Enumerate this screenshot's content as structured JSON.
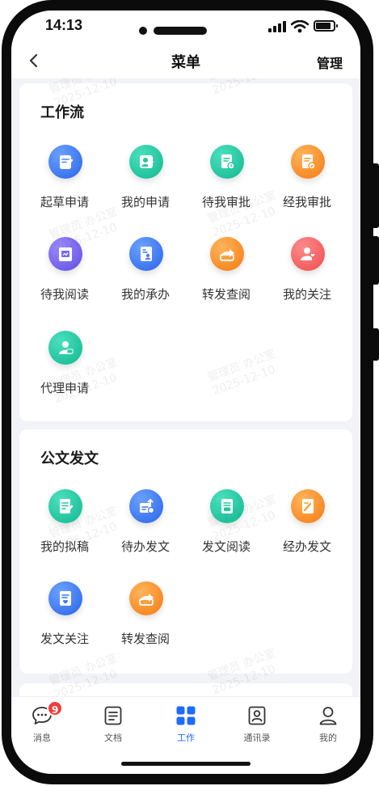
{
  "statusbar": {
    "time": "14:13"
  },
  "navbar": {
    "title": "菜单",
    "action": "管理"
  },
  "watermark": {
    "name": "管理员  办公室",
    "date": "2025-12-10"
  },
  "sections": [
    {
      "title": "工作流",
      "items": [
        {
          "label": "起草申请",
          "color": "blue",
          "icon": "edit-doc-icon"
        },
        {
          "label": "我的申请",
          "color": "teal",
          "icon": "user-sign-icon"
        },
        {
          "label": "待我审批",
          "color": "teal",
          "icon": "doc-clock-icon"
        },
        {
          "label": "经我审批",
          "color": "orange",
          "icon": "doc-check-icon"
        },
        {
          "label": "待我阅读",
          "color": "purple",
          "icon": "read-doc-icon"
        },
        {
          "label": "我的承办",
          "color": "blue",
          "icon": "id-card-icon"
        },
        {
          "label": "转发查阅",
          "color": "orange",
          "icon": "forward-icon"
        },
        {
          "label": "我的关注",
          "color": "red",
          "icon": "user-heart-icon"
        },
        {
          "label": "代理申请",
          "color": "teal",
          "icon": "agent-icon"
        }
      ]
    },
    {
      "title": "公文发文",
      "items": [
        {
          "label": "我的拟稿",
          "color": "teal",
          "icon": "draft-icon"
        },
        {
          "label": "待办发文",
          "color": "blue",
          "icon": "pending-send-icon"
        },
        {
          "label": "发文阅读",
          "color": "teal",
          "icon": "read-send-icon"
        },
        {
          "label": "经办发文",
          "color": "orange",
          "icon": "handled-send-icon"
        },
        {
          "label": "发文关注",
          "color": "blue",
          "icon": "follow-doc-icon"
        },
        {
          "label": "转发查阅",
          "color": "orange",
          "icon": "forward-icon"
        }
      ]
    }
  ],
  "tabbar": [
    {
      "label": "消息",
      "icon": "message-icon",
      "badge": "9"
    },
    {
      "label": "文档",
      "icon": "document-icon"
    },
    {
      "label": "工作",
      "icon": "work-grid-icon",
      "active": true
    },
    {
      "label": "通讯录",
      "icon": "contacts-icon"
    },
    {
      "label": "我的",
      "icon": "profile-icon"
    }
  ]
}
